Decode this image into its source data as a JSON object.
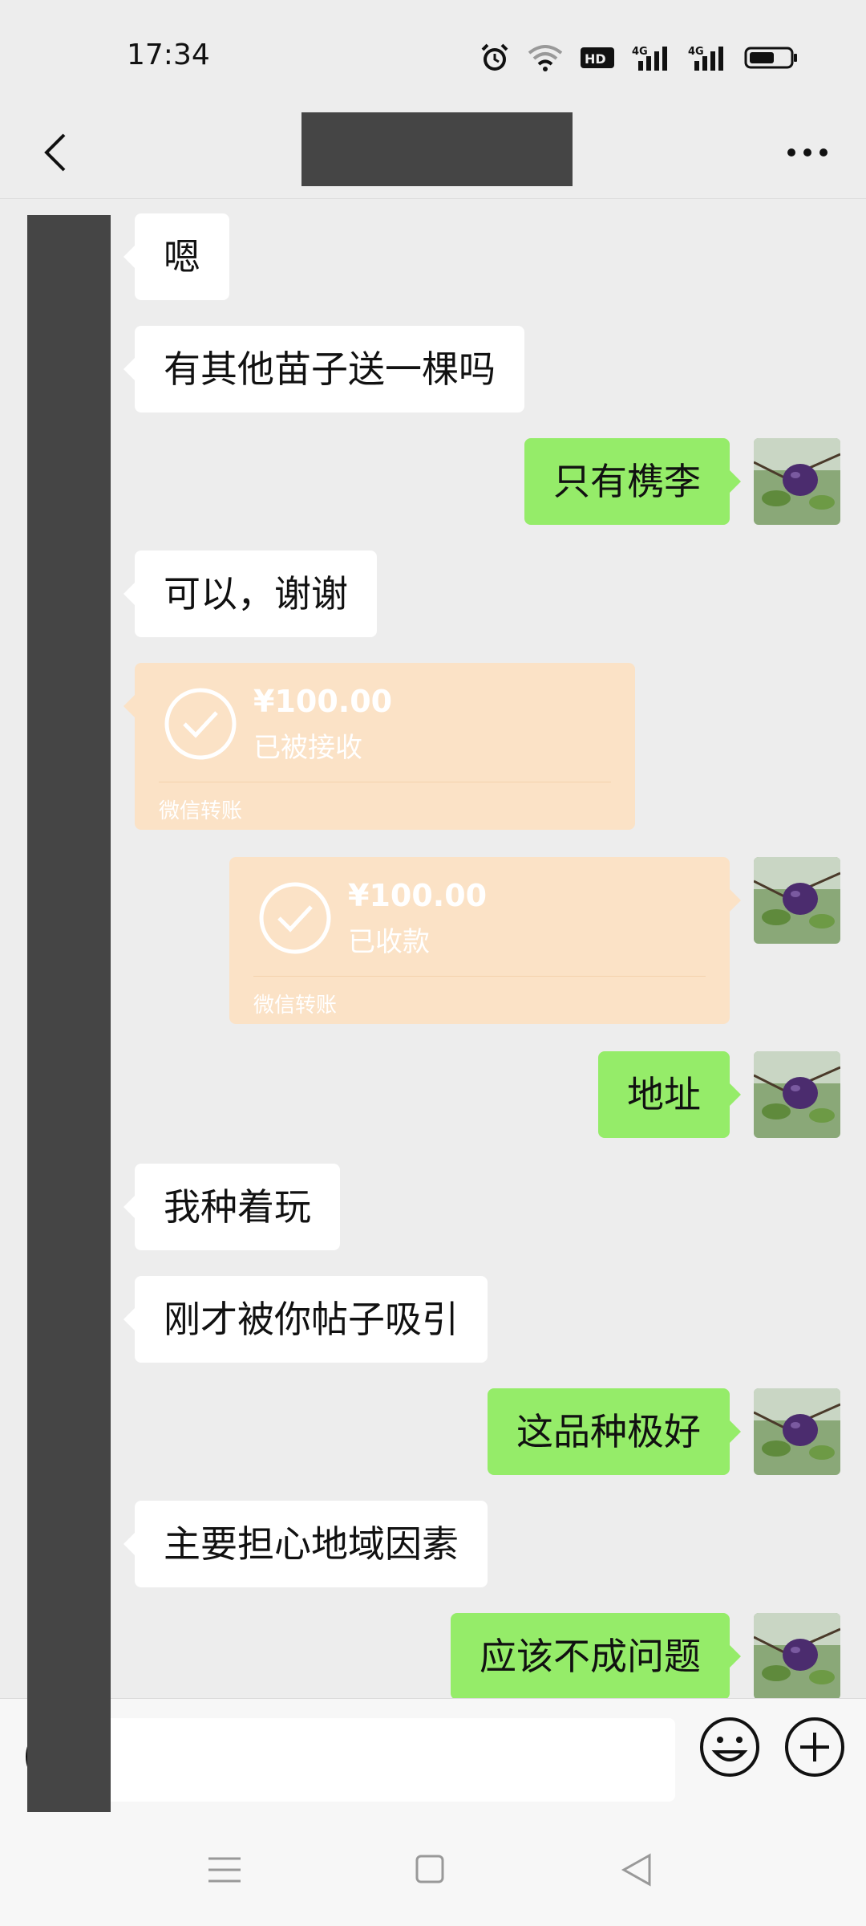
{
  "status_bar": {
    "time": "17:34",
    "icons": [
      "alarm-icon",
      "wifi-icon",
      "hd-icon",
      "signal-4g-icon",
      "signal-4g-icon",
      "battery-icon"
    ],
    "hd_label": "HD",
    "network_label": "4G"
  },
  "nav": {
    "title": "",
    "back_icon": "chevron-left-icon",
    "more_icon": "more-dots-icon"
  },
  "messages": [
    {
      "type": "text",
      "side": "in",
      "text": "嗯"
    },
    {
      "type": "text",
      "side": "in",
      "text": "有其他苗子送一棵吗"
    },
    {
      "type": "text",
      "side": "out",
      "text": "只有槜李"
    },
    {
      "type": "text",
      "side": "in",
      "text": "可以，谢谢"
    },
    {
      "type": "transfer",
      "side": "in",
      "amount": "¥100.00",
      "status": "已被接收",
      "label": "微信转账"
    },
    {
      "type": "transfer",
      "side": "out",
      "amount": "¥100.00",
      "status": "已收款",
      "label": "微信转账"
    },
    {
      "type": "text",
      "side": "out",
      "text": "地址"
    },
    {
      "type": "text",
      "side": "in",
      "text": "我种着玩"
    },
    {
      "type": "text",
      "side": "in",
      "text": "刚才被你帖子吸引"
    },
    {
      "type": "text",
      "side": "out",
      "text": "这品种极好"
    },
    {
      "type": "text",
      "side": "in",
      "text": "主要担心地域因素"
    },
    {
      "type": "text",
      "side": "out",
      "text": "应该不成问题"
    }
  ],
  "input_bar": {
    "value": "",
    "voice_icon": "voice-icon",
    "emoji_icon": "emoji-icon",
    "plus_icon": "plus-icon"
  },
  "system_nav": {
    "icons": [
      "menu-icon",
      "home-icon",
      "back-triangle-icon"
    ]
  },
  "colors": {
    "background": "#ededed",
    "incoming_bubble": "#ffffff",
    "outgoing_bubble": "#95ec69",
    "transfer_bubble": "#fbe2c6",
    "redaction": "#454545"
  }
}
